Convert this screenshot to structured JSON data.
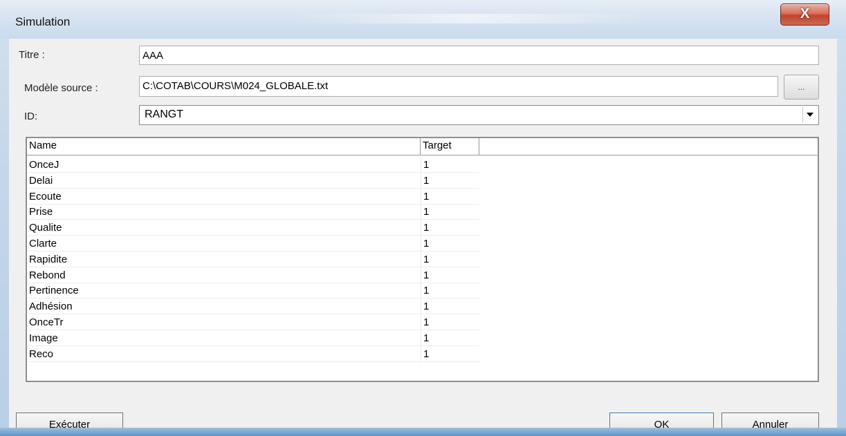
{
  "window": {
    "title": "Simulation",
    "close_glyph": "X"
  },
  "form": {
    "titre_label": "Titre :",
    "titre_value": "AAA",
    "modele_label": "Modèle source :",
    "modele_value": "C:\\COTAB\\COURS\\M024_GLOBALE.txt",
    "browse_label": "...",
    "id_label": "ID:",
    "id_value": "RANGT"
  },
  "table": {
    "columns": [
      "Name",
      "Target"
    ],
    "rows": [
      {
        "name": "OnceJ",
        "target": "1"
      },
      {
        "name": "Delai",
        "target": "1"
      },
      {
        "name": "Ecoute",
        "target": "1"
      },
      {
        "name": "Prise",
        "target": "1"
      },
      {
        "name": "Qualite",
        "target": "1"
      },
      {
        "name": "Clarte",
        "target": "1"
      },
      {
        "name": "Rapidite",
        "target": "1"
      },
      {
        "name": "Rebond",
        "target": "1"
      },
      {
        "name": "Pertinence",
        "target": "1"
      },
      {
        "name": "Adhésion",
        "target": "1"
      },
      {
        "name": "OnceTr",
        "target": "1"
      },
      {
        "name": "Image",
        "target": "1"
      },
      {
        "name": "Reco",
        "target": "1"
      }
    ]
  },
  "buttons": {
    "execute": "Exécuter",
    "ok": "OK",
    "cancel": "Annuler"
  },
  "colors": {
    "close_button": "#c3432d",
    "title_bar": "#d7e3f0",
    "dialog_face": "#f0f0f0"
  }
}
